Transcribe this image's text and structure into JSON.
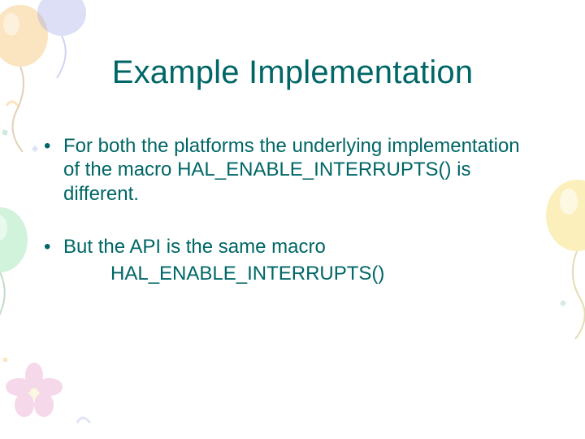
{
  "slide": {
    "title": "Example Implementation",
    "bullets": [
      {
        "text": "For both the platforms the underlying implementation of the macro HAL_ENABLE_INTERRUPTS() is different."
      },
      {
        "text": "But the API is the same macro",
        "sub": "HAL_ENABLE_INTERRUPTS()"
      }
    ]
  }
}
